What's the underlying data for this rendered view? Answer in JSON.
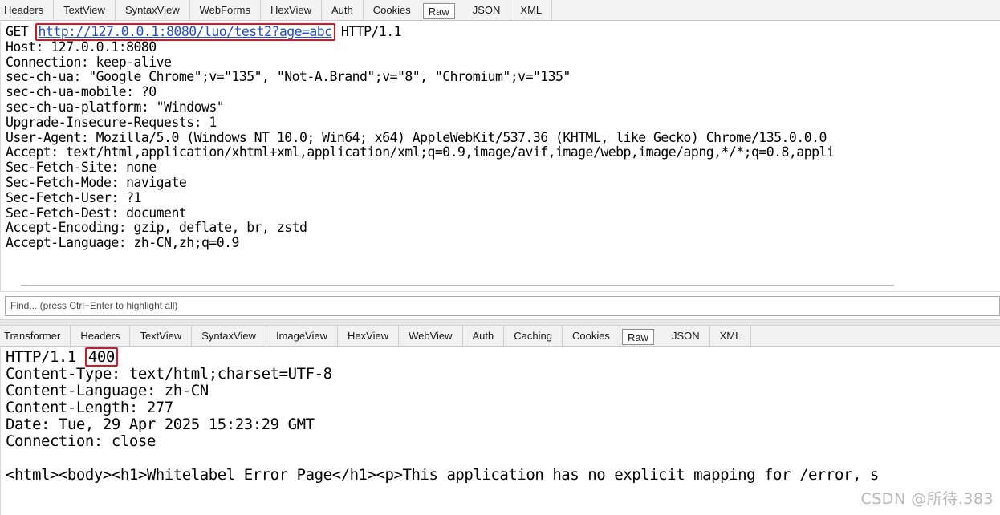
{
  "request_tabs": [
    "Headers",
    "TextView",
    "SyntaxView",
    "WebForms",
    "HexView",
    "Auth",
    "Cookies",
    "Raw",
    "JSON",
    "XML"
  ],
  "request_active_tab": "Raw",
  "request": {
    "method": "GET",
    "url": "http://127.0.0.1:8080/luo/test2?age=abc",
    "protocol": "HTTP/1.1",
    "header_lines": [
      "Host: 127.0.0.1:8080",
      "Connection: keep-alive",
      "sec-ch-ua: \"Google Chrome\";v=\"135\", \"Not-A.Brand\";v=\"8\", \"Chromium\";v=\"135\"",
      "sec-ch-ua-mobile: ?0",
      "sec-ch-ua-platform: \"Windows\"",
      "Upgrade-Insecure-Requests: 1",
      "User-Agent: Mozilla/5.0 (Windows NT 10.0; Win64; x64) AppleWebKit/537.36 (KHTML, like Gecko) Chrome/135.0.0.0",
      "Accept: text/html,application/xhtml+xml,application/xml;q=0.9,image/avif,image/webp,image/apng,*/*;q=0.8,appli",
      "Sec-Fetch-Site: none",
      "Sec-Fetch-Mode: navigate",
      "Sec-Fetch-User: ?1",
      "Sec-Fetch-Dest: document",
      "Accept-Encoding: gzip, deflate, br, zstd",
      "Accept-Language: zh-CN,zh;q=0.9"
    ]
  },
  "find_bar": {
    "placeholder": "Find... (press Ctrl+Enter to highlight all)"
  },
  "response_tabs": [
    "Transformer",
    "Headers",
    "TextView",
    "SyntaxView",
    "ImageView",
    "HexView",
    "WebView",
    "Auth",
    "Caching",
    "Cookies",
    "Raw",
    "JSON",
    "XML"
  ],
  "response_active_tab": "Raw",
  "response": {
    "protocol": "HTTP/1.1",
    "status_code": "400",
    "header_lines": [
      "Content-Type: text/html;charset=UTF-8",
      "Content-Language: zh-CN",
      "Content-Length: 277",
      "Date: Tue, 29 Apr 2025 15:23:29 GMT",
      "Connection: close"
    ],
    "body_line": "<html><body><h1>Whitelabel Error Page</h1><p>This application has no explicit mapping for /error, s"
  },
  "watermark": "CSDN @所待.383",
  "colors": {
    "highlight_border": "#e0141e",
    "url_link": "#1f4fd1"
  }
}
